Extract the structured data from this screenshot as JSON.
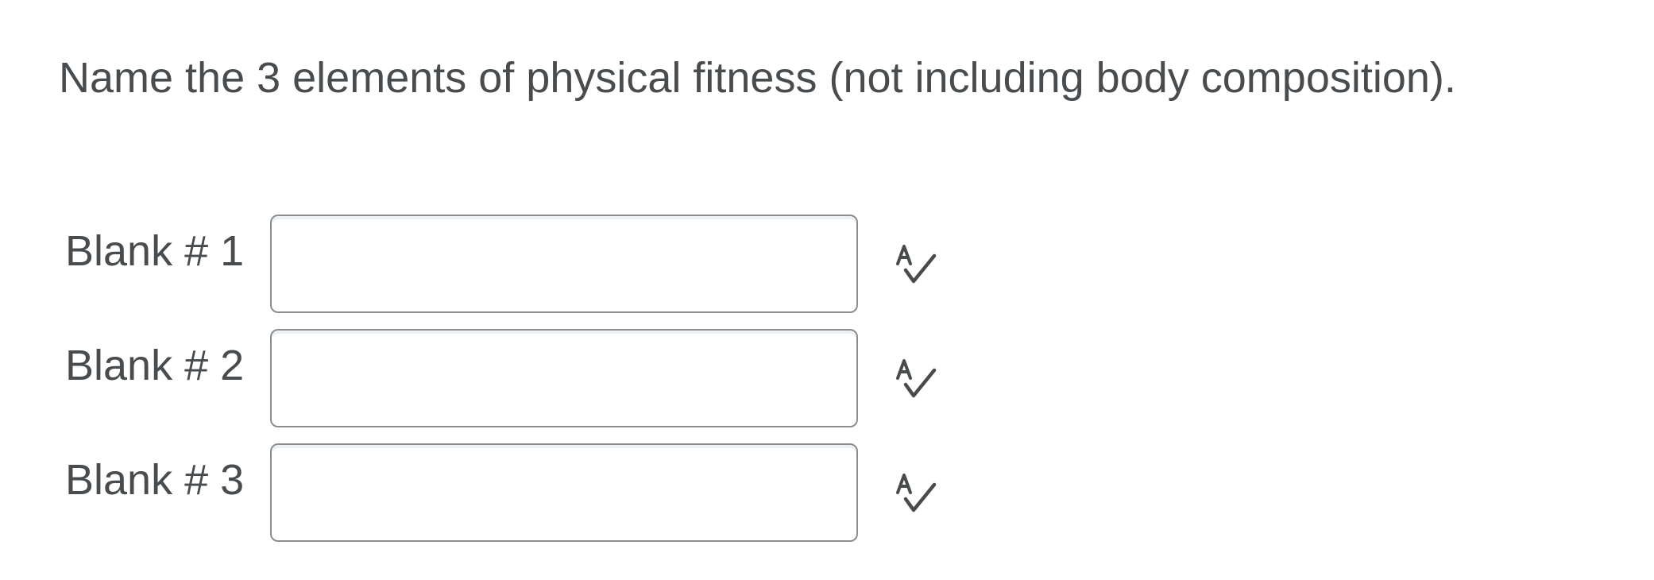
{
  "question": {
    "text": "Name the 3 elements of physical fitness (not including body composition)."
  },
  "blanks": [
    {
      "label": "Blank # 1",
      "value": "",
      "spellcheck_icon": "spellcheck-icon"
    },
    {
      "label": "Blank # 2",
      "value": "",
      "spellcheck_icon": "spellcheck-icon"
    },
    {
      "label": "Blank # 3",
      "value": "",
      "spellcheck_icon": "spellcheck-icon"
    }
  ],
  "colors": {
    "text": "#494c4e",
    "input_border": "#8b8e91",
    "icon": "#494c4e"
  }
}
